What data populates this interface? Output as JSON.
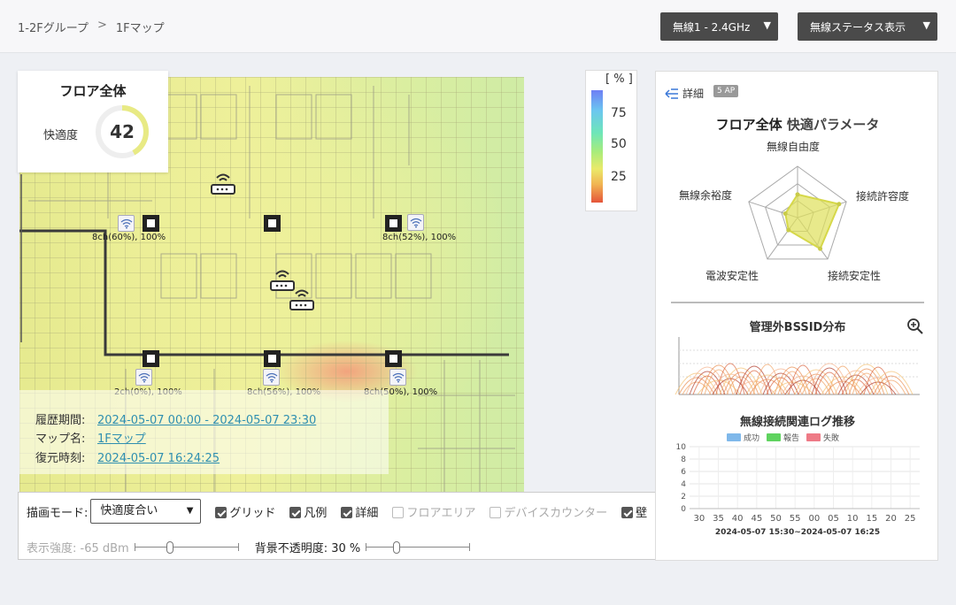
{
  "breadcrumb": {
    "group": "1-2Fグループ",
    "separator": ">",
    "map": "1Fマップ"
  },
  "header": {
    "band_dropdown": "無線1 - 2.4GHz",
    "view_dropdown": "無線ステータス表示",
    "dropdown_arrow": "▼"
  },
  "score": {
    "title": "フロア全体",
    "label": "快適度",
    "value": "42",
    "fraction": 0.42
  },
  "legend": {
    "unit": "[ % ]",
    "ticks": [
      "75",
      "50",
      "25"
    ]
  },
  "access_points": [
    {
      "label": "8ch(60%), 100%"
    },
    {
      "label": "8ch(52%), 100%"
    },
    {
      "label": "2ch(0%), 100%"
    },
    {
      "label": "8ch(56%), 100%"
    },
    {
      "label": "8ch(50%), 100%"
    }
  ],
  "info": {
    "period_key": "履歴期間:",
    "period_val": "2024-05-07 00:00 - 2024-05-07 23:30",
    "map_key": "マップ名:",
    "map_val": "1Fマップ",
    "restore_key": "復元時刻:",
    "restore_val": "2024-05-07 16:24:25"
  },
  "controls": {
    "mode_label": "描画モード:",
    "mode_value": "快適度合い",
    "grid": "グリッド",
    "legend": "凡例",
    "detail": "詳細",
    "floor_area": "フロアエリア",
    "device_counter": "デバイスカウンター",
    "wall": "壁",
    "strength_label": "表示強度: -65 dBm",
    "opacity_label": "背景不透明度: 30 %"
  },
  "panel": {
    "detail": "詳細",
    "ap_count": "5 AP",
    "title": "フロア全体",
    "title_sub": "快適パラメータ",
    "radar_labels": [
      "無線自由度",
      "接続許容度",
      "接続安定性",
      "電波安定性",
      "無線余裕度"
    ],
    "radar_values": [
      0.45,
      0.85,
      0.75,
      0.3,
      0.25
    ],
    "bssid_title": "管理外BSSID分布",
    "log_title": "無線接続関連ログ推移",
    "log_legend": [
      "成功",
      "報告",
      "失敗"
    ],
    "log_colors": [
      "#7fb8ea",
      "#5fd35f",
      "#ee7a86"
    ],
    "log_yticks": [
      "10",
      "8",
      "6",
      "4",
      "2",
      "0"
    ],
    "log_xticks": [
      "30",
      "35",
      "40",
      "45",
      "50",
      "55",
      "00",
      "05",
      "10",
      "15",
      "20",
      "25"
    ],
    "log_range": "2024-05-07 15:30~2024-05-07 16:25"
  },
  "colors": {
    "accent": "#e8ea84",
    "link": "#2f8fb0",
    "header_btn": "#4a4a4a"
  }
}
